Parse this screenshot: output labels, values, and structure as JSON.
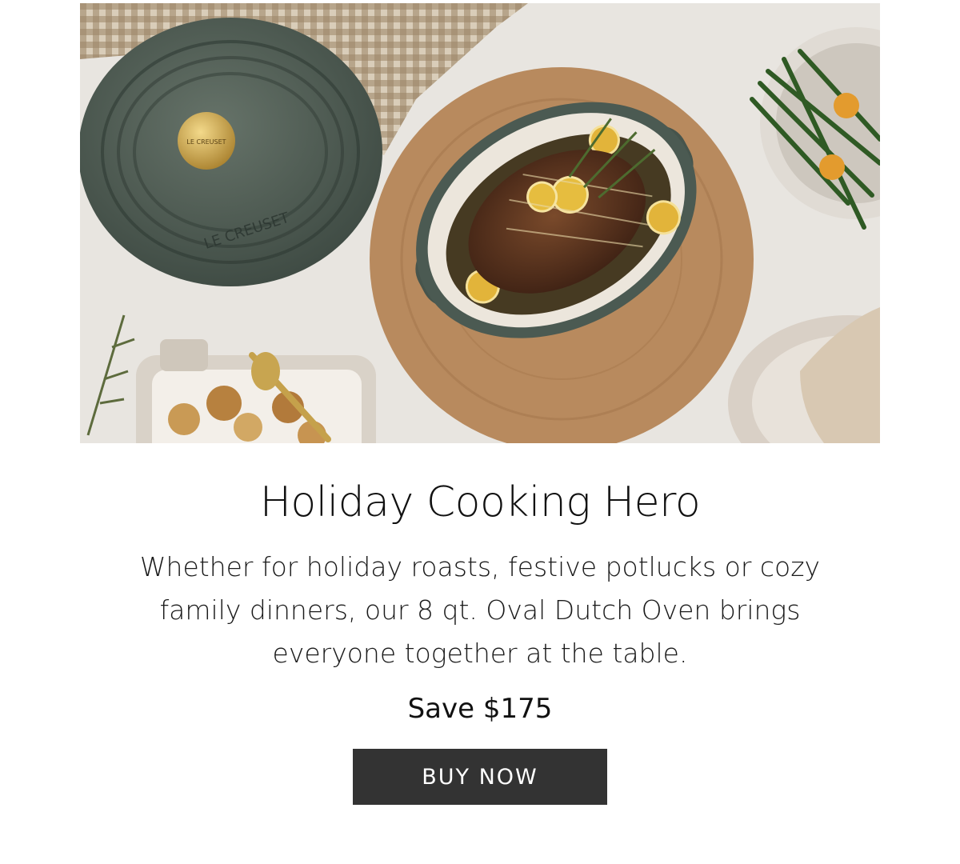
{
  "hero": {
    "lid_brand_text": "LE CREUSET",
    "knob_brand_text": "LE CREUSET",
    "colors": {
      "tablecloth": "#e8e5e0",
      "cast_iron_green": "#4b5a52",
      "enamel_interior": "#ece6dc",
      "wood_board": "#b88a5e",
      "brass_knob": "#c9a14a",
      "roast": "#5a3320",
      "lemon": "#e2b43a",
      "green_beans": "#2f5a24",
      "gingham": "#8a7356"
    }
  },
  "content": {
    "title": "Holiday Cooking Hero",
    "body_line_1": "Whether for holiday roasts, festive potlucks or cozy",
    "body_line_2": "family dinners, our 8 qt. Oval Dutch Oven brings",
    "body_line_3": "everyone together at the table.",
    "save_text": "Save $175",
    "cta_label": "BUY NOW"
  },
  "colors": {
    "button_bg": "#333333",
    "button_text": "#ffffff",
    "text": "#111111"
  }
}
